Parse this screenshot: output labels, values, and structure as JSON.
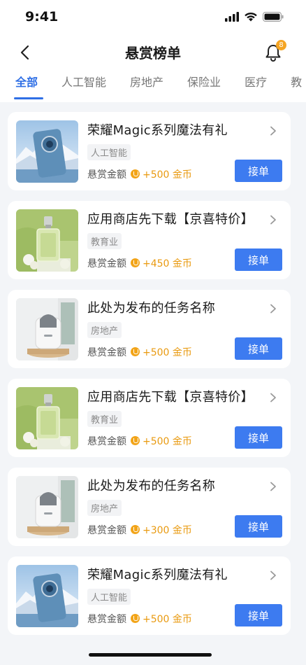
{
  "status": {
    "time": "9:41"
  },
  "nav": {
    "title": "悬赏榜单",
    "badge_count": "8"
  },
  "tabs": [
    {
      "label": "全部",
      "active": true
    },
    {
      "label": "人工智能",
      "active": false
    },
    {
      "label": "房地产",
      "active": false
    },
    {
      "label": "保险业",
      "active": false
    },
    {
      "label": "医疗",
      "active": false
    },
    {
      "label": "教",
      "active": false
    }
  ],
  "reward_label": "悬赏金额",
  "take_label": "接单",
  "items": [
    {
      "title": "荣耀Magic系列魔法有礼",
      "tag": "人工智能",
      "amount": "+500 金币",
      "image": "phone"
    },
    {
      "title": "应用商店先下载【京喜特价】",
      "tag": "教育业",
      "amount": "+450 金币",
      "image": "perfume"
    },
    {
      "title": "此处为发布的任务名称",
      "tag": "房地产",
      "amount": "+500 金币",
      "image": "device"
    },
    {
      "title": "应用商店先下载【京喜特价】",
      "tag": "教育业",
      "amount": "+500 金币",
      "image": "perfume"
    },
    {
      "title": "此处为发布的任务名称",
      "tag": "房地产",
      "amount": "+300 金币",
      "image": "device"
    },
    {
      "title": "荣耀Magic系列魔法有礼",
      "tag": "人工智能",
      "amount": "+500 金币",
      "image": "phone"
    }
  ],
  "colors": {
    "accent": "#2f6fe5",
    "button": "#3d7bf0",
    "coin": "#f2a418",
    "badge": "#f5a524"
  }
}
